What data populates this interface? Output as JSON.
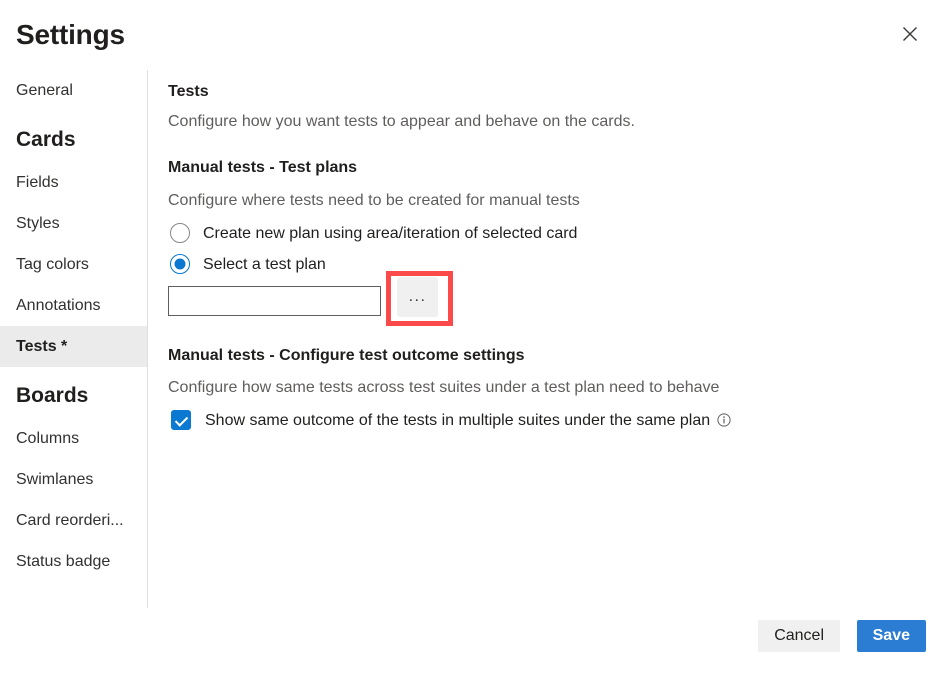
{
  "header": {
    "title": "Settings",
    "close_icon": "close-icon"
  },
  "sidebar": {
    "items": [
      {
        "label": "General",
        "type": "item",
        "selected": false
      },
      {
        "label": "Cards",
        "type": "group"
      },
      {
        "label": "Fields",
        "type": "item",
        "selected": false
      },
      {
        "label": "Styles",
        "type": "item",
        "selected": false
      },
      {
        "label": "Tag colors",
        "type": "item",
        "selected": false
      },
      {
        "label": "Annotations",
        "type": "item",
        "selected": false
      },
      {
        "label": "Tests *",
        "type": "item",
        "selected": true
      },
      {
        "label": "Boards",
        "type": "group"
      },
      {
        "label": "Columns",
        "type": "item",
        "selected": false
      },
      {
        "label": "Swimlanes",
        "type": "item",
        "selected": false
      },
      {
        "label": "Card reorderi...",
        "type": "item",
        "selected": false
      },
      {
        "label": "Status badge",
        "type": "item",
        "selected": false
      }
    ]
  },
  "main": {
    "tests": {
      "heading": "Tests",
      "description": "Configure how you want tests to appear and behave on the cards."
    },
    "manual_tests_plans": {
      "heading": "Manual tests - Test plans",
      "description": "Configure where tests need to be created for manual tests",
      "options": [
        {
          "label": "Create new plan using area/iteration of selected card",
          "selected": false
        },
        {
          "label": "Select a test plan",
          "selected": true
        }
      ],
      "test_plan_input": {
        "value": "",
        "placeholder": ""
      },
      "ellipsis_button_label": "...",
      "highlight_color": "#fb4a4a"
    },
    "outcome_settings": {
      "heading": "Manual tests - Configure test outcome settings",
      "description": "Configure how same tests across test suites under a test plan need to behave",
      "checkbox": {
        "label": "Show same outcome of the tests in multiple suites under the same plan",
        "checked": true,
        "info_icon": "info-icon"
      }
    }
  },
  "footer": {
    "cancel_label": "Cancel",
    "save_label": "Save",
    "save_color": "#2b7cd3"
  }
}
